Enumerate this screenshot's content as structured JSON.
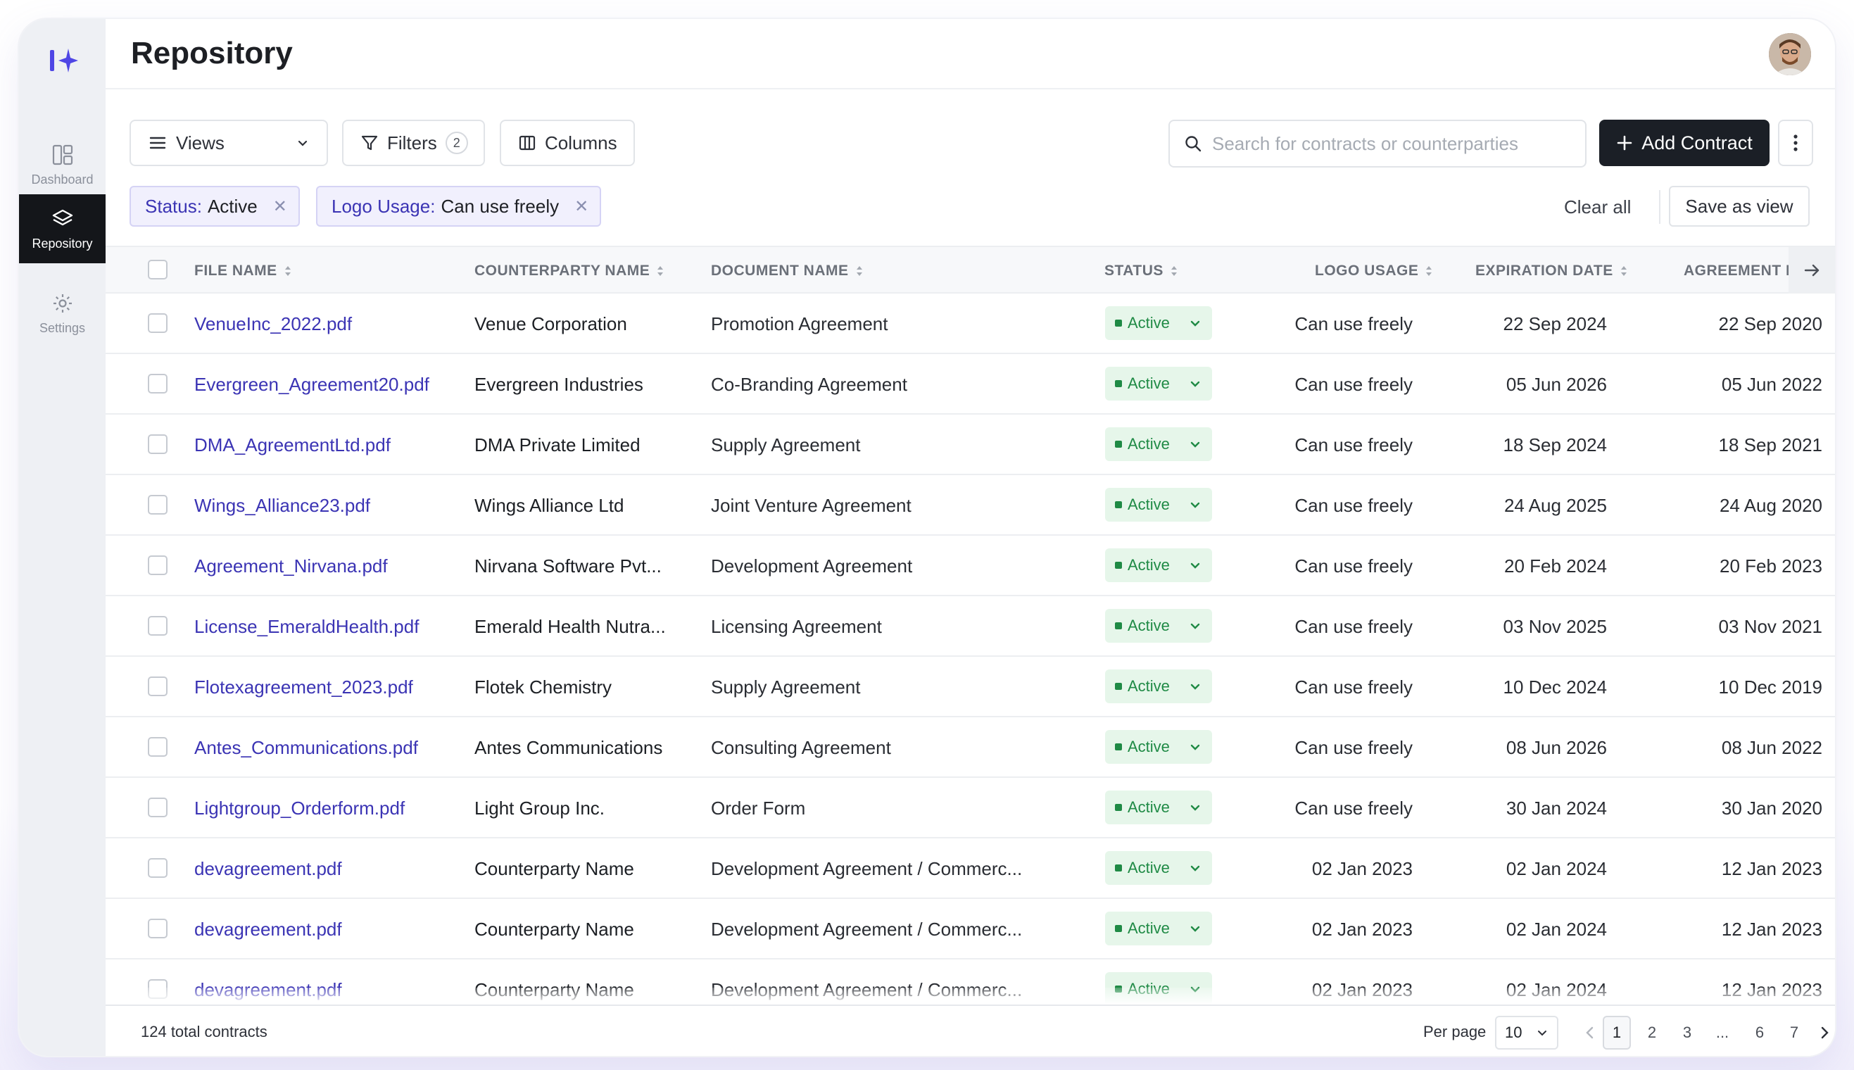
{
  "sidebar": {
    "items": [
      {
        "label": "Dashboard",
        "icon": "dashboard-icon"
      },
      {
        "label": "Repository",
        "icon": "layers-icon",
        "active": true
      },
      {
        "label": "Settings",
        "icon": "gear-icon"
      }
    ]
  },
  "header": {
    "title": "Repository"
  },
  "toolbar": {
    "views_label": "Views",
    "filters_label": "Filters",
    "filters_count": "2",
    "columns_label": "Columns",
    "search_placeholder": "Search for contracts or counterparties",
    "add_label": "Add Contract"
  },
  "active_filters": [
    {
      "key": "Status:",
      "value": "Active"
    },
    {
      "key": "Logo Usage:",
      "value": "Can use freely"
    }
  ],
  "filter_actions": {
    "clear_all": "Clear all",
    "save_view": "Save as view"
  },
  "table": {
    "columns": [
      "FILE NAME",
      "COUNTERPARTY NAME",
      "DOCUMENT NAME",
      "STATUS",
      "LOGO USAGE",
      "EXPIRATION DATE",
      "AGREEMENT DAT"
    ],
    "rows": [
      {
        "file": "VenueInc_2022.pdf",
        "counterparty": "Venue Corporation",
        "document": "Promotion Agreement",
        "status": "Active",
        "logo": "Can use freely",
        "expiration": "22 Sep 2024",
        "agreement": "22 Sep 2020"
      },
      {
        "file": "Evergreen_Agreement20.pdf",
        "counterparty": "Evergreen Industries",
        "document": "Co-Branding Agreement",
        "status": "Active",
        "logo": "Can use freely",
        "expiration": "05 Jun 2026",
        "agreement": "05 Jun 2022"
      },
      {
        "file": "DMA_AgreementLtd.pdf",
        "counterparty": "DMA Private Limited",
        "document": "Supply Agreement",
        "status": "Active",
        "logo": "Can use freely",
        "expiration": "18 Sep 2024",
        "agreement": "18 Sep 2021"
      },
      {
        "file": "Wings_Alliance23.pdf",
        "counterparty": "Wings Alliance Ltd",
        "document": "Joint Venture Agreement",
        "status": "Active",
        "logo": "Can use freely",
        "expiration": "24 Aug 2025",
        "agreement": "24 Aug 2020"
      },
      {
        "file": "Agreement_Nirvana.pdf",
        "counterparty": "Nirvana Software Pvt...",
        "document": "Development Agreement",
        "status": "Active",
        "logo": "Can use freely",
        "expiration": "20 Feb 2024",
        "agreement": "20 Feb 2023"
      },
      {
        "file": "License_EmeraldHealth.pdf",
        "counterparty": "Emerald Health Nutra...",
        "document": "Licensing Agreement",
        "status": "Active",
        "logo": "Can use freely",
        "expiration": "03 Nov 2025",
        "agreement": "03 Nov 2021"
      },
      {
        "file": "Flotexagreement_2023.pdf",
        "counterparty": "Flotek Chemistry",
        "document": "Supply Agreement",
        "status": "Active",
        "logo": "Can use freely",
        "expiration": "10 Dec 2024",
        "agreement": "10 Dec 2019"
      },
      {
        "file": "Antes_Communications.pdf",
        "counterparty": "Antes Communications",
        "document": "Consulting Agreement",
        "status": "Active",
        "logo": "Can use freely",
        "expiration": "08 Jun 2026",
        "agreement": "08 Jun 2022"
      },
      {
        "file": "Lightgroup_Orderform.pdf",
        "counterparty": "Light Group Inc.",
        "document": "Order Form",
        "status": "Active",
        "logo": "Can use freely",
        "expiration": "30 Jan 2024",
        "agreement": "30 Jan 2020"
      },
      {
        "file": "devagreement.pdf",
        "counterparty": "Counterparty Name",
        "document": "Development Agreement / Commerc...",
        "status": "Active",
        "logo": "02 Jan 2023",
        "expiration": "02 Jan 2024",
        "agreement": "12 Jan 2023"
      },
      {
        "file": "devagreement.pdf",
        "counterparty": "Counterparty Name",
        "document": "Development Agreement / Commerc...",
        "status": "Active",
        "logo": "02 Jan 2023",
        "expiration": "02 Jan 2024",
        "agreement": "12 Jan 2023"
      },
      {
        "file": "devagreement.pdf",
        "counterparty": "Counterparty Name",
        "document": "Development Agreement / Commerc...",
        "status": "Active",
        "logo": "02 Jan 2023",
        "expiration": "02 Jan 2024",
        "agreement": "12 Jan 2023"
      }
    ]
  },
  "footer": {
    "total": "124 total contracts",
    "per_page_label": "Per page",
    "per_page_value": "10",
    "pages": [
      "1",
      "2",
      "3",
      "...",
      "6",
      "7"
    ],
    "current_page": "1"
  },
  "colors": {
    "accent": "#3b34b4",
    "status_green": "#1f8a45",
    "dark": "#1b1f26"
  }
}
